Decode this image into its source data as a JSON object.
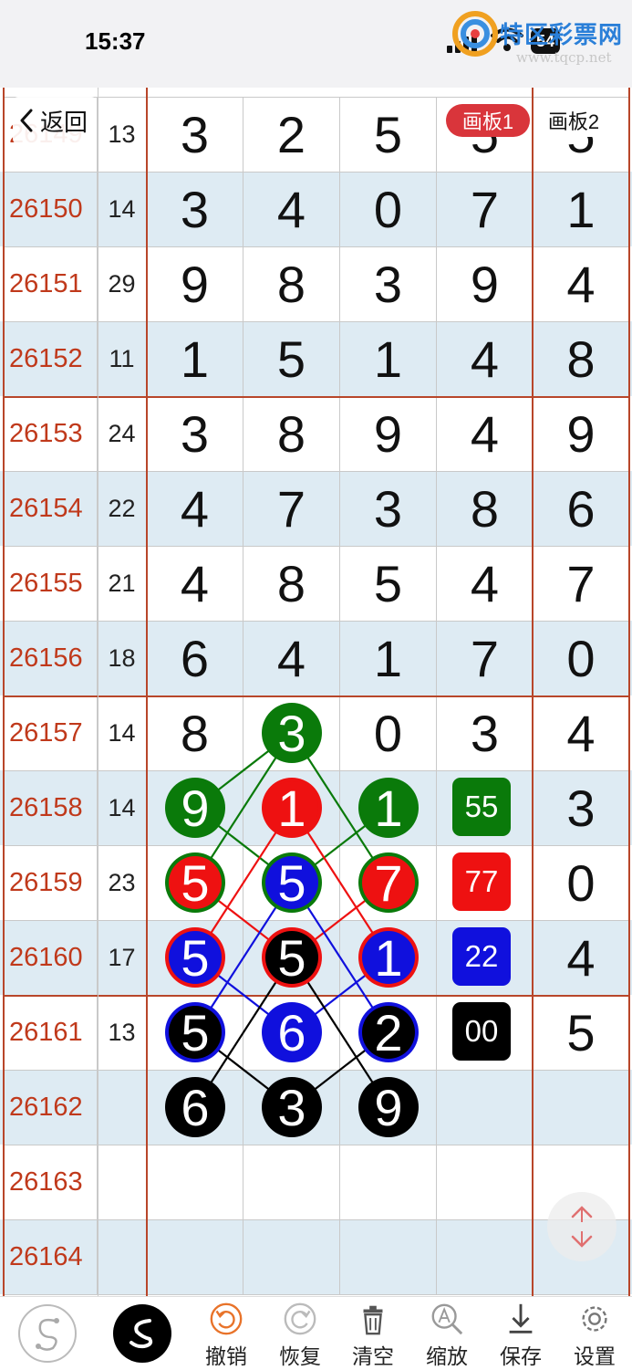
{
  "status": {
    "time": "15:37",
    "battery": "54"
  },
  "watermark": {
    "name": "特区彩票网",
    "url": "www.tqcp.net"
  },
  "nav": {
    "back_label": "返回",
    "board1": "画板1",
    "board2": "画板2"
  },
  "rows": [
    {
      "issue": "26149",
      "sum": "13",
      "d": [
        "3",
        "2",
        "5",
        "5",
        "5"
      ]
    },
    {
      "issue": "26150",
      "sum": "14",
      "d": [
        "3",
        "4",
        "0",
        "7",
        "1"
      ]
    },
    {
      "issue": "26151",
      "sum": "29",
      "d": [
        "9",
        "8",
        "3",
        "9",
        "4"
      ]
    },
    {
      "issue": "26152",
      "sum": "11",
      "d": [
        "1",
        "5",
        "1",
        "4",
        "8"
      ]
    },
    {
      "issue": "26153",
      "sum": "24",
      "d": [
        "3",
        "8",
        "9",
        "4",
        "9"
      ]
    },
    {
      "issue": "26154",
      "sum": "22",
      "d": [
        "4",
        "7",
        "3",
        "8",
        "6"
      ]
    },
    {
      "issue": "26155",
      "sum": "21",
      "d": [
        "4",
        "8",
        "5",
        "4",
        "7"
      ]
    },
    {
      "issue": "26156",
      "sum": "18",
      "d": [
        "6",
        "4",
        "1",
        "7",
        "0"
      ]
    },
    {
      "issue": "26157",
      "sum": "14",
      "d": [
        "8",
        "",
        "0",
        "3",
        "4"
      ]
    },
    {
      "issue": "26158",
      "sum": "14",
      "d": [
        "",
        "",
        "",
        "",
        "3"
      ]
    },
    {
      "issue": "26159",
      "sum": "23",
      "d": [
        "",
        "",
        "",
        "",
        "0"
      ]
    },
    {
      "issue": "26160",
      "sum": "17",
      "d": [
        "",
        "",
        "",
        "",
        "4"
      ]
    },
    {
      "issue": "26161",
      "sum": "13",
      "d": [
        "",
        "",
        "",
        "",
        "5"
      ]
    },
    {
      "issue": "26162",
      "sum": "",
      "d": [
        "",
        "",
        "",
        "",
        ""
      ]
    },
    {
      "issue": "26163",
      "sum": "",
      "d": [
        "",
        "",
        "",
        "",
        ""
      ]
    },
    {
      "issue": "26164",
      "sum": "",
      "d": [
        "",
        "",
        "",
        "",
        ""
      ]
    }
  ],
  "circles": [
    {
      "row": 8,
      "col": 1,
      "n": "3",
      "fill": "#0a7a0a",
      "ring": "#0a7a0a"
    },
    {
      "row": 9,
      "col": 0,
      "n": "9",
      "fill": "#0a7a0a",
      "ring": "#0a7a0a"
    },
    {
      "row": 9,
      "col": 1,
      "n": "1",
      "fill": "#ee1111",
      "ring": "#ee1111"
    },
    {
      "row": 9,
      "col": 2,
      "n": "1",
      "fill": "#0a7a0a",
      "ring": "#0a7a0a"
    },
    {
      "row": 10,
      "col": 0,
      "n": "5",
      "fill": "#ee1111",
      "ring": "#0a7a0a"
    },
    {
      "row": 10,
      "col": 1,
      "n": "5",
      "fill": "#1010dd",
      "ring": "#0a7a0a"
    },
    {
      "row": 10,
      "col": 2,
      "n": "7",
      "fill": "#ee1111",
      "ring": "#0a7a0a"
    },
    {
      "row": 11,
      "col": 0,
      "n": "5",
      "fill": "#1010dd",
      "ring": "#ee1111"
    },
    {
      "row": 11,
      "col": 1,
      "n": "5",
      "fill": "#000000",
      "ring": "#ee1111"
    },
    {
      "row": 11,
      "col": 2,
      "n": "1",
      "fill": "#1010dd",
      "ring": "#ee1111"
    },
    {
      "row": 12,
      "col": 0,
      "n": "5",
      "fill": "#000000",
      "ring": "#1010dd"
    },
    {
      "row": 12,
      "col": 1,
      "n": "6",
      "fill": "#1010dd",
      "ring": "#1010dd"
    },
    {
      "row": 12,
      "col": 2,
      "n": "2",
      "fill": "#000000",
      "ring": "#1010dd"
    },
    {
      "row": 13,
      "col": 0,
      "n": "6",
      "fill": "#000000",
      "ring": "#000000"
    },
    {
      "row": 13,
      "col": 1,
      "n": "3",
      "fill": "#000000",
      "ring": "#000000"
    },
    {
      "row": 13,
      "col": 2,
      "n": "9",
      "fill": "#000000",
      "ring": "#000000"
    }
  ],
  "lines": [
    {
      "from": [
        8,
        1
      ],
      "to": [
        9,
        0
      ],
      "color": "#0a7a0a"
    },
    {
      "from": [
        8,
        1
      ],
      "to": [
        10,
        0
      ],
      "color": "#0a7a0a"
    },
    {
      "from": [
        9,
        0
      ],
      "to": [
        10,
        1
      ],
      "color": "#0a7a0a"
    },
    {
      "from": [
        8,
        1
      ],
      "to": [
        10,
        2
      ],
      "color": "#0a7a0a"
    },
    {
      "from": [
        9,
        2
      ],
      "to": [
        10,
        1
      ],
      "color": "#0a7a0a"
    },
    {
      "from": [
        9,
        1
      ],
      "to": [
        11,
        0
      ],
      "color": "#ee1111"
    },
    {
      "from": [
        10,
        0
      ],
      "to": [
        11,
        1
      ],
      "color": "#ee1111"
    },
    {
      "from": [
        9,
        1
      ],
      "to": [
        11,
        2
      ],
      "color": "#ee1111"
    },
    {
      "from": [
        10,
        2
      ],
      "to": [
        11,
        1
      ],
      "color": "#ee1111"
    },
    {
      "from": [
        10,
        1
      ],
      "to": [
        12,
        0
      ],
      "color": "#1010dd"
    },
    {
      "from": [
        11,
        0
      ],
      "to": [
        12,
        1
      ],
      "color": "#1010dd"
    },
    {
      "from": [
        10,
        1
      ],
      "to": [
        12,
        2
      ],
      "color": "#1010dd"
    },
    {
      "from": [
        11,
        2
      ],
      "to": [
        12,
        1
      ],
      "color": "#1010dd"
    },
    {
      "from": [
        11,
        1
      ],
      "to": [
        13,
        0
      ],
      "color": "#000000"
    },
    {
      "from": [
        12,
        0
      ],
      "to": [
        13,
        1
      ],
      "color": "#000000"
    },
    {
      "from": [
        11,
        1
      ],
      "to": [
        13,
        2
      ],
      "color": "#000000"
    },
    {
      "from": [
        12,
        2
      ],
      "to": [
        13,
        1
      ],
      "color": "#000000"
    }
  ],
  "tags": [
    {
      "row": 9,
      "label": "55",
      "color": "#0a7a0a"
    },
    {
      "row": 10,
      "label": "77",
      "color": "#ee1111"
    },
    {
      "row": 11,
      "label": "22",
      "color": "#1010dd"
    },
    {
      "row": 12,
      "label": "00",
      "color": "#000000"
    }
  ],
  "toolbar": {
    "undo": "撤销",
    "redo": "恢复",
    "clear": "清空",
    "zoom": "缩放",
    "save": "保存",
    "settings": "设置"
  }
}
